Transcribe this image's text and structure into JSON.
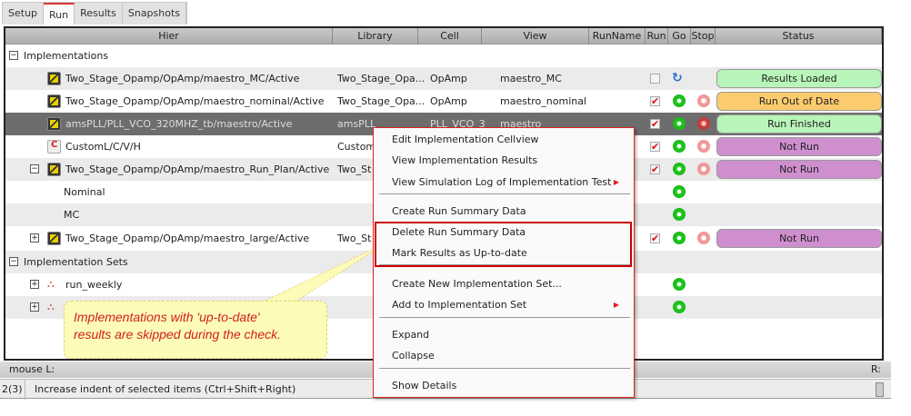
{
  "tabs": [
    "Setup",
    "Run",
    "Results",
    "Snapshots"
  ],
  "active_tab": "Run",
  "columns": [
    "Hier",
    "Library",
    "Cell",
    "View",
    "RunName",
    "Run",
    "Go",
    "Stop",
    "Status"
  ],
  "rows": [
    {
      "hier": "Implementations",
      "type": "group"
    },
    {
      "hier": "Two_Stage_Opamp/OpAmp/maestro_MC/Active",
      "library": "Two_Stage_Opa...",
      "cell": "OpAmp",
      "view": "maestro_MC",
      "run": false,
      "status": "Results Loaded"
    },
    {
      "hier": "Two_Stage_Opamp/OpAmp/maestro_nominal/Active",
      "library": "Two_Stage_Opa...",
      "cell": "OpAmp",
      "view": "maestro_nominal",
      "run": true,
      "status": "Run Out of Date"
    },
    {
      "hier": "amsPLL/PLL_VCO_320MHZ_tb/maestro/Active",
      "library": "amsPLL",
      "cell": "PLL_VCO_3...",
      "view": "maestro",
      "run": true,
      "status": "Run Finished"
    },
    {
      "hier": "CustomL/C/V/H",
      "library": "Custom",
      "run": true,
      "status": "Not Run"
    },
    {
      "hier": "Two_Stage_Opamp/OpAmp/maestro_Run_Plan/Active",
      "library": "Two_St",
      "run": true,
      "status": "Not Run"
    },
    {
      "hier": "Nominal"
    },
    {
      "hier": "MC"
    },
    {
      "hier": "Two_Stage_Opamp/OpAmp/maestro_large/Active",
      "library": "Two_St",
      "run": true,
      "status": "Not Run"
    },
    {
      "hier": "Implementation Sets",
      "type": "group"
    },
    {
      "hier": "run_weekly"
    },
    {
      "hier": ""
    }
  ],
  "status_colors": {
    "Results Loaded": "#b8f5b8",
    "Run Out of Date": "#fccb6e",
    "Run Finished": "#b8f5b8",
    "Not Run": "#cf8fcf"
  },
  "context_menu": {
    "items": [
      "Edit Implementation Cellview",
      "View Implementation Results",
      "View Simulation Log of Implementation Test",
      "Create Run Summary Data",
      "Delete Run Summary Data",
      "Mark Results as Up-to-date",
      "Create New Implementation Set...",
      "Add to Implementation Set",
      "Expand",
      "Collapse",
      "Show Details"
    ]
  },
  "callout": {
    "line1": "Implementations with 'up-to-date'",
    "line2": "results are skipped during the check."
  },
  "statusbar": {
    "mouse_l": "mouse L:",
    "mouse_r": "R:",
    "counter": "2(3)",
    "message": "Increase indent of selected items (Ctrl+Shift+Right)"
  }
}
